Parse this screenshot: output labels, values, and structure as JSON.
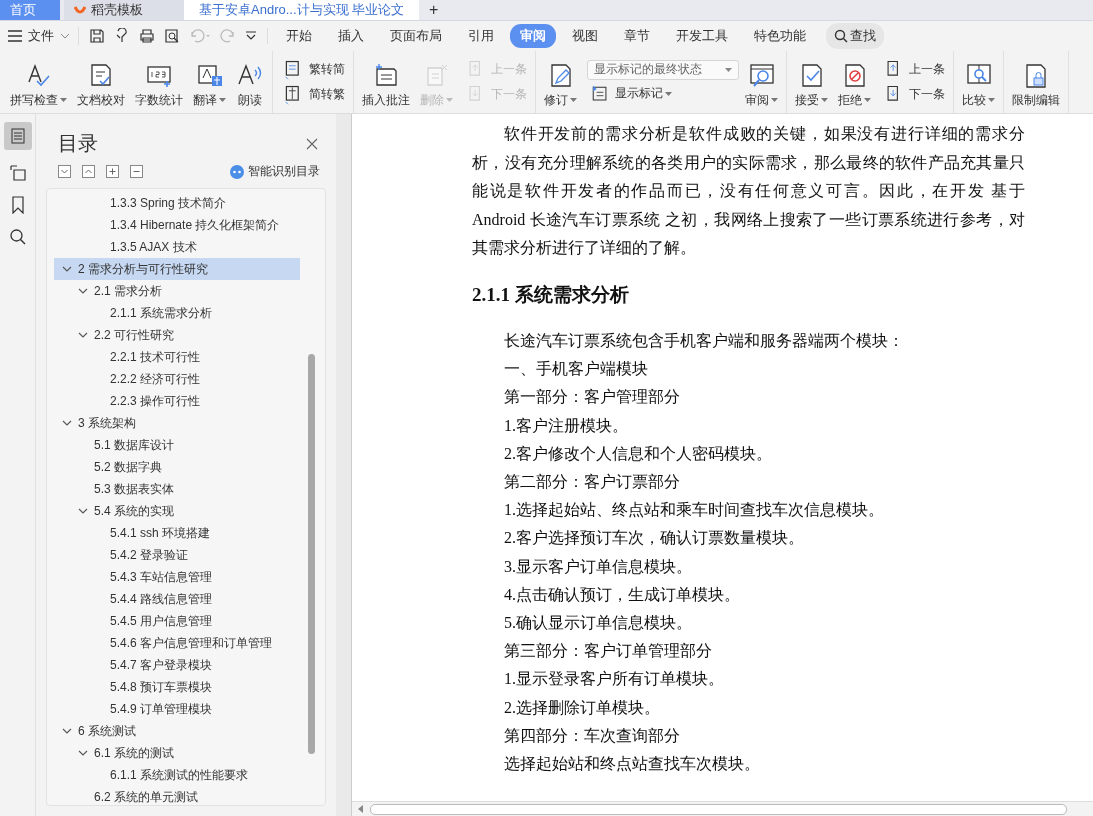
{
  "top_tabs": [
    {
      "label": "首页",
      "kind": "home",
      "selected": false
    },
    {
      "label": "稻壳模板",
      "kind": "template",
      "selected": false
    },
    {
      "label": "基于安卓Andro...计与实现 毕业论文",
      "kind": "document",
      "selected": true
    }
  ],
  "new_tab": "+",
  "file_menu": "文件",
  "menu_tabs": [
    {
      "label": "开始",
      "selected": false
    },
    {
      "label": "插入",
      "selected": false
    },
    {
      "label": "页面布局",
      "selected": false
    },
    {
      "label": "引用",
      "selected": false
    },
    {
      "label": "审阅",
      "selected": true
    },
    {
      "label": "视图",
      "selected": false
    },
    {
      "label": "章节",
      "selected": false
    },
    {
      "label": "开发工具",
      "selected": false
    },
    {
      "label": "特色功能",
      "selected": false
    }
  ],
  "search_button": "查找",
  "ribbon": [
    {
      "columns": [
        {
          "kind": "large",
          "items": [
            {
              "kind": "button",
              "label": "拼写检查",
              "menu": true,
              "disabled": false
            }
          ]
        },
        {
          "kind": "large",
          "items": [
            {
              "kind": "button",
              "label": "文档校对",
              "menu": false,
              "disabled": false
            }
          ]
        },
        {
          "kind": "large",
          "items": [
            {
              "kind": "button",
              "label": "字数统计",
              "menu": false,
              "disabled": false
            }
          ]
        },
        {
          "kind": "large",
          "items": [
            {
              "kind": "button",
              "label": "翻译",
              "menu": true,
              "disabled": false
            }
          ]
        },
        {
          "kind": "large",
          "items": [
            {
              "kind": "button",
              "label": "朗读",
              "menu": false,
              "disabled": false
            }
          ]
        }
      ]
    },
    {
      "columns": [
        {
          "kind": "stack",
          "items": [
            {
              "kind": "button",
              "label": "繁转简",
              "menu": false,
              "disabled": false
            },
            {
              "kind": "button",
              "label": "简转繁",
              "menu": false,
              "disabled": false
            }
          ]
        }
      ]
    },
    {
      "columns": [
        {
          "kind": "large",
          "items": [
            {
              "kind": "button",
              "label": "插入批注",
              "menu": false,
              "disabled": false
            }
          ]
        },
        {
          "kind": "large",
          "items": [
            {
              "kind": "button",
              "label": "删除",
              "menu": true,
              "disabled": true
            }
          ]
        },
        {
          "kind": "stack",
          "items": [
            {
              "kind": "button",
              "label": "上一条",
              "menu": false,
              "disabled": true
            },
            {
              "kind": "button",
              "label": "下一条",
              "menu": false,
              "disabled": true
            }
          ]
        }
      ]
    },
    {
      "columns": [
        {
          "kind": "large",
          "items": [
            {
              "kind": "button",
              "label": "修订",
              "menu": true,
              "disabled": false
            }
          ]
        },
        {
          "kind": "stack",
          "items": [
            {
              "kind": "select",
              "label": "显示标记的最终状态",
              "menu": true,
              "disabled": false
            },
            {
              "kind": "button",
              "label": "显示标记",
              "menu": true,
              "disabled": false
            }
          ]
        },
        {
          "kind": "large",
          "items": [
            {
              "kind": "button",
              "label": "审阅",
              "menu": true,
              "disabled": false
            }
          ]
        }
      ]
    },
    {
      "columns": [
        {
          "kind": "large",
          "items": [
            {
              "kind": "button",
              "label": "接受",
              "menu": true,
              "disabled": false
            }
          ]
        },
        {
          "kind": "large",
          "items": [
            {
              "kind": "button",
              "label": "拒绝",
              "menu": true,
              "disabled": false
            }
          ]
        },
        {
          "kind": "stack",
          "items": [
            {
              "kind": "button",
              "label": "上一条",
              "menu": false,
              "disabled": false
            },
            {
              "kind": "button",
              "label": "下一条",
              "menu": false,
              "disabled": false
            }
          ]
        }
      ]
    },
    {
      "columns": [
        {
          "kind": "large",
          "items": [
            {
              "kind": "button",
              "label": "比较",
              "menu": true,
              "disabled": false
            }
          ]
        }
      ]
    },
    {
      "columns": [
        {
          "kind": "large",
          "items": [
            {
              "kind": "button",
              "label": "限制编辑",
              "menu": false,
              "disabled": false
            }
          ]
        }
      ]
    }
  ],
  "sidebar": {
    "title": "目录",
    "smart_toc": "智能识别目录",
    "toc": [
      {
        "children": [
          {
            "children": [
              {
                "label": "1.3.3 Spring 技术简介",
                "selected": false
              },
              {
                "label": "1.3.4 Hibernate 持久化框架简介",
                "selected": false
              },
              {
                "label": "1.3.5 AJAX 技术",
                "selected": false
              }
            ]
          }
        ]
      },
      {
        "label": "2  需求分析与可行性研究",
        "selected": true,
        "expanded": true,
        "children": [
          {
            "label": "2.1 需求分析",
            "selected": false,
            "expanded": true,
            "children": [
              {
                "label": "2.1.1 系统需求分析",
                "selected": false
              }
            ]
          },
          {
            "label": "2.2 可行性研究",
            "selected": false,
            "expanded": true,
            "children": [
              {
                "label": "2.2.1 技术可行性",
                "selected": false
              },
              {
                "label": "2.2.2 经济可行性",
                "selected": false
              },
              {
                "label": "2.2.3 操作可行性",
                "selected": false
              }
            ]
          }
        ]
      },
      {
        "label": "3 系统架构",
        "selected": false,
        "expanded": true,
        "children": [
          {
            "label": "5.1 数据库设计",
            "selected": false
          },
          {
            "label": "5.2 数据字典",
            "selected": false
          },
          {
            "label": "5.3  数据表实体",
            "selected": false
          },
          {
            "label": "5.4 系统的实现",
            "selected": false,
            "expanded": true,
            "children": [
              {
                "label": "5.4.1 ssh 环境搭建",
                "selected": false
              },
              {
                "label": "5.4.2 登录验证",
                "selected": false
              },
              {
                "label": "5.4.3 车站信息管理",
                "selected": false
              },
              {
                "label": "5.4.4 路线信息管理",
                "selected": false
              },
              {
                "label": "5.4.5 用户信息管理",
                "selected": false
              },
              {
                "label": "5.4.6 客户信息管理和订单管理",
                "selected": false
              },
              {
                "label": "5.4.7 客户登录模块",
                "selected": false
              },
              {
                "label": "5.4.8 预订车票模块",
                "selected": false
              },
              {
                "label": "5.4.9  订单管理模块",
                "selected": false
              }
            ]
          }
        ]
      },
      {
        "label": "6  系统测试",
        "selected": false,
        "expanded": true,
        "children": [
          {
            "label": "6.1 系统的测试",
            "selected": false,
            "expanded": true,
            "children": [
              {
                "label": "6.1.1 系统测试的性能要求",
                "selected": false
              }
            ]
          },
          {
            "label": "6.2 系统的单元测试",
            "selected": false
          }
        ]
      }
    ]
  },
  "document": {
    "intro": "软件开发前的需求分析是软件成败的关键，如果没有进行详细的需求分析，没有充分理解系统的各类用户的实际需求，那么最终的软件产品充其量只能说是软件开发者的作品而已，没有任何意义可言。因此，在开发 基于 Android 长途汽车订票系统 之初，我网络上搜索了一些订票系统进行参考，对其需求分析进行了详细的了解。",
    "heading": "2.1.1 系统需求分析",
    "lines": [
      "长途汽车订票系统包含手机客户端和服务器端两个模块：",
      "一、手机客户端模块",
      "第一部分：客户管理部分",
      "1.客户注册模块。",
      "2.客户修改个人信息和个人密码模块。",
      "第二部分：客户订票部分",
      "1.选择起始站、终点站和乘车时间查找车次信息模块。",
      "2.客户选择预订车次，确认订票数量模块。",
      "3.显示客户订单信息模块。",
      "4.点击确认预订，生成订单模块。",
      "5.确认显示订单信息模块。",
      "第三部分：客户订单管理部分",
      "1.显示登录客户所有订单模块。",
      "2.选择删除订单模块。",
      "第四部分：车次查询部分",
      "选择起始站和终点站查找车次模块。"
    ]
  }
}
